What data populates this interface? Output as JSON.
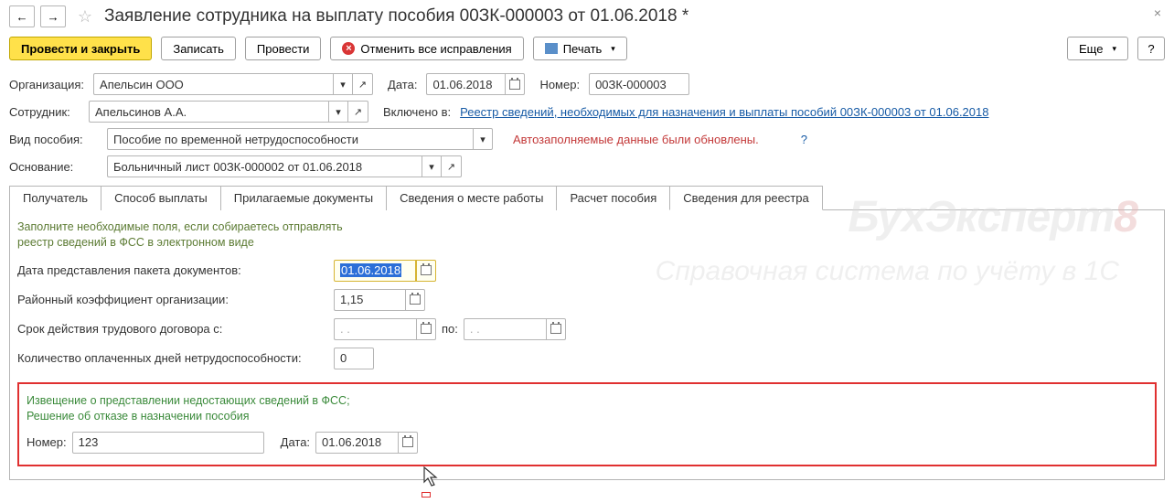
{
  "header": {
    "title": "Заявление сотрудника на выплату пособия 00ЗК-000003 от 01.06.2018 *"
  },
  "toolbar": {
    "post_close": "Провести и закрыть",
    "save": "Записать",
    "post": "Провести",
    "cancel_fixes": "Отменить все исправления",
    "print": "Печать",
    "more": "Еще",
    "help": "?"
  },
  "form": {
    "org_label": "Организация:",
    "org_value": "Апельсин ООО",
    "date_label": "Дата:",
    "date_value": "01.06.2018",
    "num_label": "Номер:",
    "num_value": "00ЗК-000003",
    "employee_label": "Сотрудник:",
    "employee_value": "Апельсинов А.А.",
    "included_label": "Включено в:",
    "included_link": "Реестр сведений, необходимых для назначения и выплаты пособий 00ЗК-000003 от 01.06.2018",
    "benefit_type_label": "Вид пособия:",
    "benefit_type_value": "Пособие по временной нетрудоспособности",
    "auto_fill_msg": "Автозаполняемые данные были обновлены.",
    "basis_label": "Основание:",
    "basis_value": "Больничный лист 00ЗК-000002 от 01.06.2018"
  },
  "tabs": {
    "t1": "Получатель",
    "t2": "Способ выплаты",
    "t3": "Прилагаемые документы",
    "t4": "Сведения о месте работы",
    "t5": "Расчет пособия",
    "t6": "Сведения для реестра"
  },
  "content": {
    "hint_line1": "Заполните необходимые поля, если собираетесь отправлять",
    "hint_line2": "реестр сведений в ФСС в электронном виде",
    "f1_label": "Дата представления пакета документов:",
    "f1_value": "01.06.2018",
    "f2_label": "Районный коэффициент организации:",
    "f2_value": "1,15",
    "f3_label": "Срок действия трудового договора с:",
    "f3_empty": "  .  .    ",
    "f3_to": "по:",
    "f4_label": "Количество оплаченных дней нетрудоспособности:",
    "f4_value": "0",
    "notice_title1": "Извещение о представлении недостающих сведений в ФСС;",
    "notice_title2": "Решение об отказе в назначении пособия",
    "notice_num_label": "Номер:",
    "notice_num_value": "123",
    "notice_date_label": "Дата:",
    "notice_date_value": "01.06.2018"
  },
  "watermark": {
    "main": "БухЭксперт",
    "eight": "8",
    "sub": "Справочная система по учёту в 1С"
  }
}
